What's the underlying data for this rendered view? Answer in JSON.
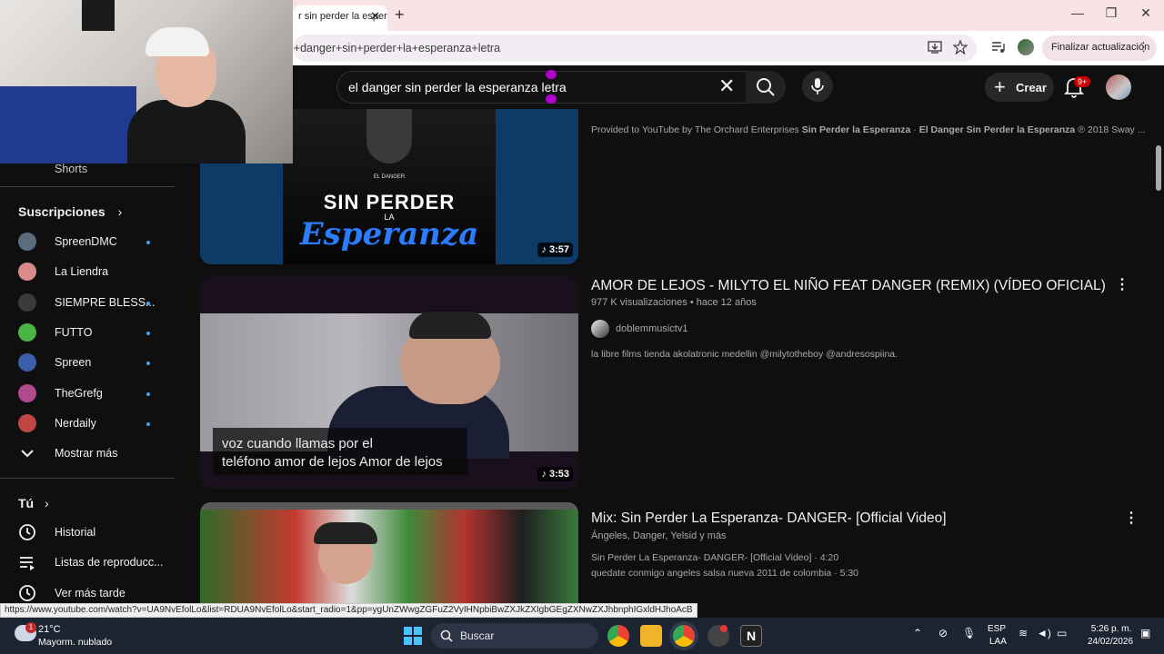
{
  "browser": {
    "tab_title": "r sin perder la esperanza",
    "tab_close": "✕",
    "new_tab": "+",
    "url": "l+danger+sin+perder+la+esperanza+letra",
    "update_button": "Finalizar actualización",
    "window_controls": {
      "minimize": "—",
      "maximize": "❐",
      "close": "✕"
    }
  },
  "header": {
    "search_value": "el danger sin perder la esperanza letra",
    "create_label": "Crear",
    "notifications_badge": "9+"
  },
  "sidebar": {
    "shorts_label": "Shorts",
    "subscriptions_heading": "Suscripciones",
    "subscriptions": [
      {
        "label": "SpreenDMC",
        "color": "#5b6c7c"
      },
      {
        "label": "La Liendra",
        "color": "#d98b8b"
      },
      {
        "label": "SIEMPRE BLESS...",
        "color": "#3a3a3a"
      },
      {
        "label": "FUTTO",
        "color": "#4bb543"
      },
      {
        "label": "Spreen",
        "color": "#3a5fa8"
      },
      {
        "label": "TheGrefg",
        "color": "#b04a8c"
      },
      {
        "label": "Nerdaily",
        "color": "#c04545"
      }
    ],
    "show_more": "Mostrar más",
    "you_heading": "Tú",
    "you_items": [
      {
        "label": "Historial"
      },
      {
        "label": "Listas de reproducc..."
      },
      {
        "label": "Ver más tarde"
      }
    ]
  },
  "videos": [
    {
      "duration": "3:57",
      "thumb_line1": "SIN PERDER",
      "thumb_line2": "LA",
      "thumb_line3": "Esperanza",
      "thumb_small": "EL DANGER",
      "description_prefix": "Provided to YouTube by The Orchard Enterprises ",
      "description_bold1": "Sin Perder la Esperanza",
      "description_mid": " · ",
      "description_bold2": "El Danger Sin Perder la Esperanza",
      "description_suffix": " ℗ 2018 Sway ..."
    },
    {
      "title": "AMOR DE LEJOS - MILYTO EL NIÑO FEAT DANGER (REMIX) (VÍDEO OFICIAL)",
      "views": "977 K visualizaciones",
      "age": "hace 12 años",
      "channel": "doblemmusictv1",
      "description": "la libre films tienda akolatronic medellin @milytotheboy @andresospiina.",
      "caption_line1": "voz cuando llamas por el",
      "caption_line2": "teléfono amor de lejos Amor de lejos",
      "duration": "3:53"
    },
    {
      "title": "Mix: Sin Perder La Esperanza- DANGER- [Official Video]",
      "artists": "Ángeles, Danger, Yelsid y más",
      "track1": "Sin Perder La Esperanza- DANGER- [Official Video] · 4:20",
      "track2": "quedate conmigo angeles salsa nueva 2011 de colombia · 5:30"
    }
  ],
  "status_url": "https://www.youtube.com/watch?v=UA9NvEfolLo&list=RDUA9NvEfolLo&start_radio=1&pp=ygUnZWwgZGFuZ2VyIHNpbiBwZXJkZXIgbGEgZXNwZXJhbnphIGxldHJhoAcB",
  "taskbar": {
    "weather_badge": "1",
    "weather_temp": "21°C",
    "weather_desc": "Mayorm. nublado",
    "search_label": "Buscar",
    "lang_top": "ESP",
    "lang_bottom": "LAA",
    "time": "5:26 p. m.",
    "date": "24/02/2026"
  }
}
